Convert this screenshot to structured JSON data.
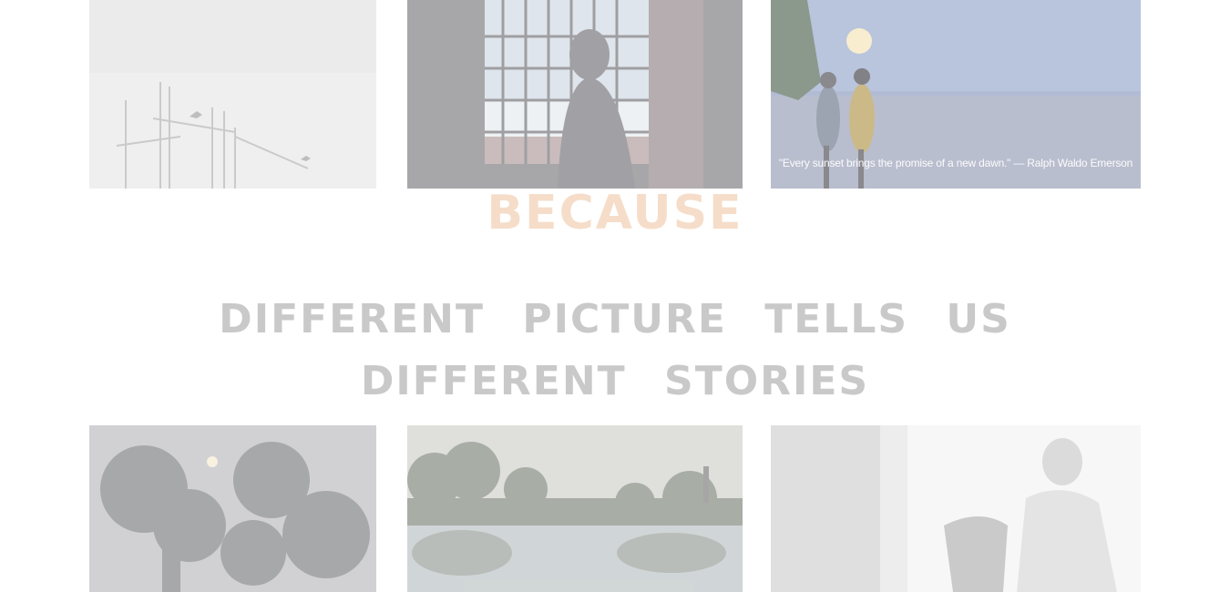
{
  "gallery_top": {
    "photo_1": {
      "alt": "birds over antenna masts"
    },
    "photo_2": {
      "alt": "child at window"
    },
    "photo_3": {
      "alt": "two boys at sunset",
      "caption": "\"Every sunset brings the promise of a new dawn.\" — Ralph Waldo Emerson"
    }
  },
  "headline": {
    "because": "BECAUSE",
    "line_1": "DIFFERENT PICTURE TELLS US",
    "line_2": "DIFFERENT STORIES"
  },
  "gallery_bottom": {
    "photo_4": {
      "alt": "tree silhouette"
    },
    "photo_5": {
      "alt": "lake reflection"
    },
    "photo_6": {
      "alt": "person on bench"
    }
  },
  "colors": {
    "because": "#f5ddc9",
    "tagline": "#c9c9c9",
    "background": "#ffffff"
  }
}
